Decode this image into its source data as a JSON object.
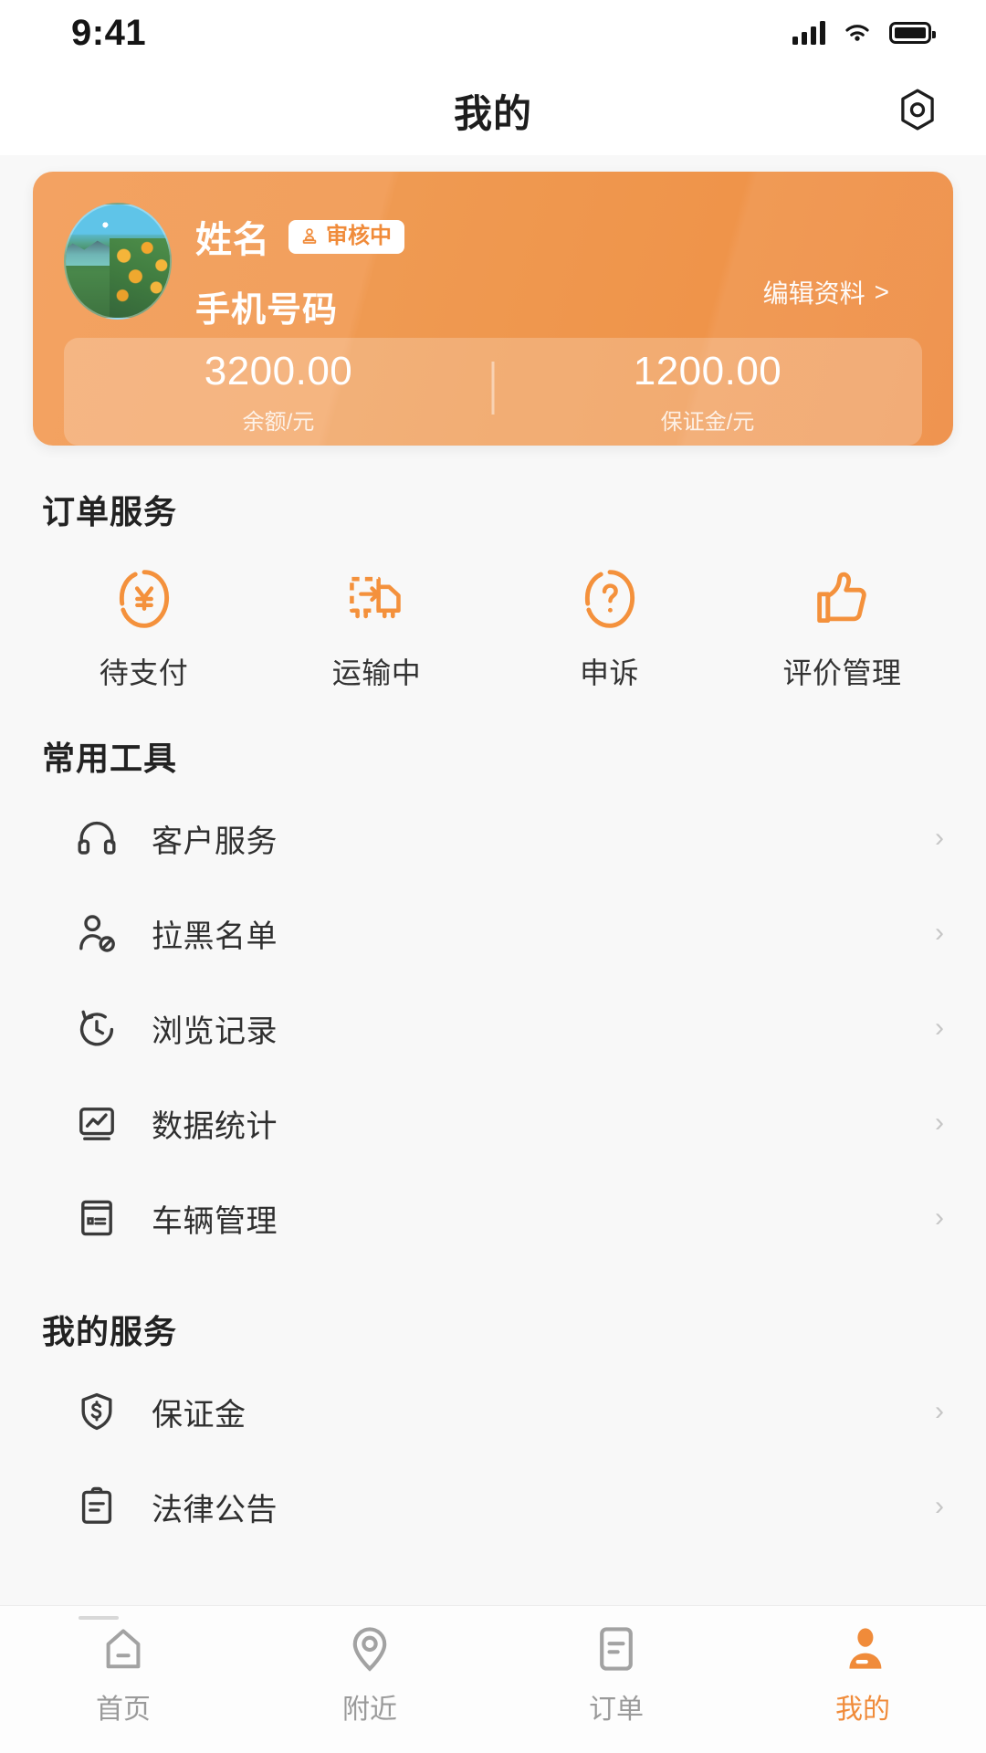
{
  "status_bar": {
    "time": "9:41",
    "signal_icon": "cellular-signal-icon",
    "wifi_icon": "wifi-icon",
    "battery_icon": "battery-icon"
  },
  "header": {
    "title": "我的",
    "action_icon": "settings-hexagon-icon"
  },
  "profile": {
    "avatar_icon": "avatar-landscape-image",
    "name": "姓名",
    "badge": {
      "label": "审核中",
      "icon": "stamp-icon"
    },
    "phone": "手机号码",
    "edit_label": "编辑资料",
    "edit_chevron": ">",
    "balance": [
      {
        "value": "3200.00",
        "label": "余额/元"
      },
      {
        "value": "1200.00",
        "label": "保证金/元"
      }
    ]
  },
  "order_services": {
    "title": "订单服务",
    "items": [
      {
        "label": "待支付",
        "icon": "yuan-circle-icon"
      },
      {
        "label": "运输中",
        "icon": "truck-icon"
      },
      {
        "label": "申诉",
        "icon": "question-circle-icon"
      },
      {
        "label": "评价管理",
        "icon": "thumbs-up-icon"
      }
    ]
  },
  "common_tools": {
    "title": "常用工具",
    "items": [
      {
        "label": "客户服务",
        "icon": "headset-icon",
        "chevron": "›"
      },
      {
        "label": "拉黑名单",
        "icon": "person-block-icon",
        "chevron": "›"
      },
      {
        "label": "浏览记录",
        "icon": "history-clock-icon",
        "chevron": "›"
      },
      {
        "label": "数据统计",
        "icon": "chart-square-icon",
        "chevron": "›"
      },
      {
        "label": "车辆管理",
        "icon": "vehicle-card-icon",
        "chevron": "›"
      }
    ]
  },
  "my_services": {
    "title": "我的服务",
    "items": [
      {
        "label": "保证金",
        "icon": "shield-dollar-icon",
        "chevron": "›"
      },
      {
        "label": "法律公告",
        "icon": "clipboard-icon",
        "chevron": "›"
      }
    ]
  },
  "tabbar": {
    "items": [
      {
        "label": "首页",
        "icon": "home-icon",
        "active": false
      },
      {
        "label": "附近",
        "icon": "location-pin-icon",
        "active": false
      },
      {
        "label": "订单",
        "icon": "order-document-icon",
        "active": false
      },
      {
        "label": "我的",
        "icon": "user-profile-icon",
        "active": true
      }
    ]
  },
  "colors": {
    "accent": "#f08b3a",
    "card_gradient_start": "#f3a262",
    "card_gradient_end": "#ef944a",
    "text_primary": "#2b2b2b",
    "text_secondary": "#9a9a9a",
    "background": "#f8f8f8"
  }
}
